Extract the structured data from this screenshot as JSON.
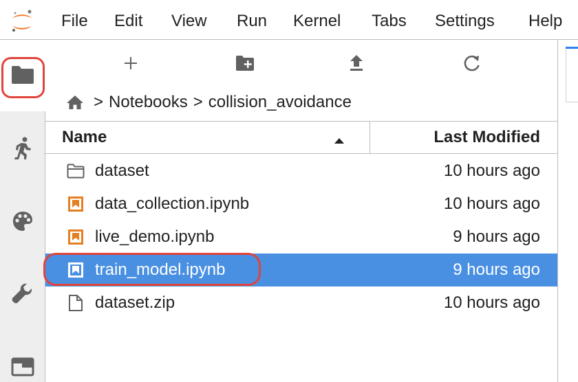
{
  "menubar": {
    "items": [
      "File",
      "Edit",
      "View",
      "Run",
      "Kernel",
      "Tabs",
      "Settings",
      "Help"
    ]
  },
  "sidebar": {
    "tabs": [
      {
        "icon": "folder-icon",
        "active": true
      },
      {
        "icon": "running-icon",
        "active": false
      },
      {
        "icon": "palette-icon",
        "active": false
      },
      {
        "icon": "wrench-icon",
        "active": false
      },
      {
        "icon": "tabs-icon",
        "active": false
      }
    ]
  },
  "toolbar": {
    "buttons": [
      "new-launcher-icon",
      "new-folder-icon",
      "upload-icon",
      "refresh-icon"
    ]
  },
  "breadcrumbs": {
    "home_icon": "home-icon",
    "separator": ">",
    "items": [
      "Notebooks",
      "collision_avoidance"
    ]
  },
  "file_list": {
    "headers": {
      "name": "Name",
      "modified": "Last Modified"
    },
    "sort": "ascending",
    "rows": [
      {
        "name": "dataset",
        "modified": "10 hours ago",
        "type": "folder"
      },
      {
        "name": "data_collection.ipynb",
        "modified": "10 hours ago",
        "type": "notebook"
      },
      {
        "name": "live_demo.ipynb",
        "modified": "9 hours ago",
        "type": "notebook"
      },
      {
        "name": "train_model.ipynb",
        "modified": "9 hours ago",
        "type": "notebook",
        "selected": true
      },
      {
        "name": "dataset.zip",
        "modified": "10 hours ago",
        "type": "file"
      }
    ]
  },
  "colors": {
    "selection": "#4a90e2",
    "notebook_orange": "#e67e22",
    "highlight_red": "#e0443a",
    "logo_orange": "#f37726"
  }
}
